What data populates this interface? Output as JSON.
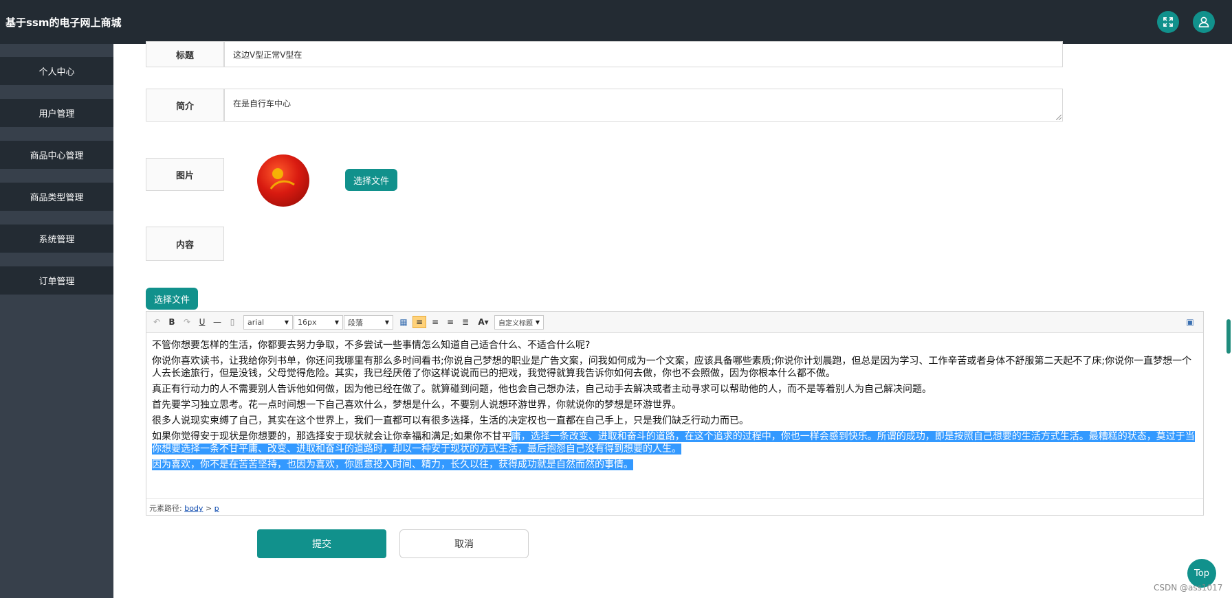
{
  "app": {
    "title": "基于ssm的电子网上商城"
  },
  "header": {
    "fullscreen_icon": "expand-icon",
    "user_icon": "user-icon"
  },
  "sidebar": {
    "items": [
      {
        "label": "个人中心"
      },
      {
        "label": "用户管理"
      },
      {
        "label": "商品中心管理"
      },
      {
        "label": "商品类型管理"
      },
      {
        "label": "系统管理"
      },
      {
        "label": "订单管理"
      }
    ]
  },
  "form": {
    "title_label": "标题",
    "title_value": "这边V型正常V型在",
    "intro_label": "简介",
    "intro_value": "在是自行车中心",
    "image_label": "图片",
    "choose_file_label": "选择文件",
    "content_label": "内容",
    "content_choose_file_label": "选择文件"
  },
  "toolbar": {
    "font_family": "arial",
    "font_size": "16px",
    "paragraph": "段落",
    "custom_title": "自定义标题"
  },
  "content": {
    "p1": "不管你想要怎样的生活，你都要去努力争取，不多尝试一些事情怎么知道自己适合什么、不适合什么呢?",
    "p2": "你说你喜欢读书，让我给你列书单，你还问我哪里有那么多时间看书;你说自己梦想的职业是广告文案，问我如何成为一个文案，应该具备哪些素质;你说你计划晨跑，但总是因为学习、工作辛苦或者身体不舒服第二天起不了床;你说你一直梦想一个人去长途旅行，但是没钱，父母觉得危险。其实，我已经厌倦了你这样说说而已的把戏，我觉得就算我告诉你如何去做，你也不会照做，因为你根本什么都不做。",
    "p3": "真正有行动力的人不需要别人告诉他如何做，因为他已经在做了。就算碰到问题，他也会自己想办法，自己动手去解决或者主动寻求可以帮助他的人，而不是等着别人为自己解决问题。",
    "p4": "首先要学习独立思考。花一点时间想一下自己喜欢什么，梦想是什么，不要别人说想环游世界，你就说你的梦想是环游世界。",
    "p5": "很多人说现实束缚了自己，其实在这个世界上，我们一直都可以有很多选择，生活的决定权也一直都在自己手上，只是我们缺乏行动力而已。",
    "p6_plain": "如果你觉得安于现状是你想要的，那选择安于现状就会让你幸福和满足;如果你不甘平",
    "p6_selected": "庸，选择一条改变、进取和奋斗的道路，在这个追求的过程中，你也一样会感到快乐。所谓的成功，即是按照自己想要的生活方式生活。最糟糕的状态，莫过于当你想要选择一条不甘平庸、改变、进取和奋斗的道路时，却以一种安于现状的方式生活，最后抱怨自己没有得到想要的人生。",
    "p7_selected": "因为喜欢，你不是在苦苦坚持，也因为喜欢，你愿意投入时间、精力，长久以往，获得成功就是自然而然的事情。"
  },
  "element_path": {
    "prefix": "元素路径:",
    "body": "body",
    "sep": ">",
    "p": "p"
  },
  "actions": {
    "submit": "提交",
    "cancel": "取消"
  },
  "floating": {
    "top": "Top"
  },
  "watermark": "CSDN @ass1017"
}
